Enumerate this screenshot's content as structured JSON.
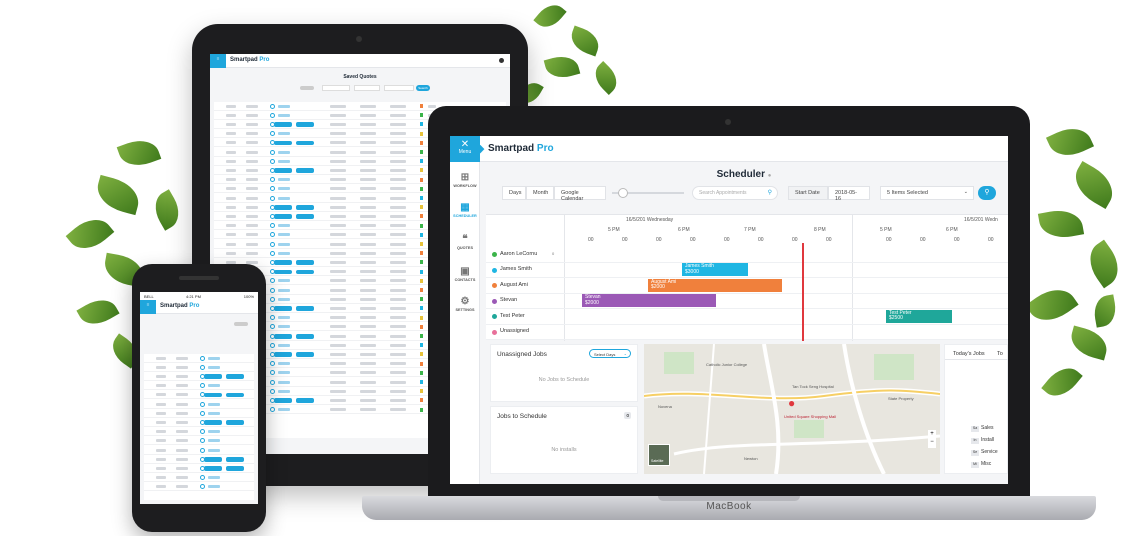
{
  "colors": {
    "accent": "#1fa6dc",
    "aaron": "#3bb44a",
    "james": "#1fb6e3",
    "august": "#f0803c",
    "stevan": "#9b59b6",
    "test_peter": "#1fa79a",
    "unassigned": "#e8709a",
    "now_line": "#e0383e"
  },
  "laptop": {
    "brand": "Smartpad",
    "brand_pro": "Pro",
    "menu_label": "Menu",
    "sidebar": [
      {
        "label": "WORKFLOW",
        "icon": "workflow-icon"
      },
      {
        "label": "SCHEDULER",
        "icon": "calendar-icon",
        "active": true
      },
      {
        "label": "QUOTES",
        "icon": "quotes-icon"
      },
      {
        "label": "CONTACTS",
        "icon": "contacts-icon"
      },
      {
        "label": "SETTINGS",
        "icon": "gear-icon"
      }
    ],
    "page_title": "Scheduler",
    "toolbar": {
      "days": "Days",
      "month": "Month",
      "google_calendar": "Google Calendar",
      "search_placeholder": "Search Appointments",
      "start_date_label": "Start Date",
      "start_date_value": "2018-05-16",
      "items_selected": "5 Items Selected"
    },
    "grid": {
      "date_heading_1": "16/5/201 Wednesday",
      "date_heading_2": "16/5/201 Wedn",
      "hours": [
        "6 PM",
        "7 PM",
        "8 PM",
        "5 PM",
        "6 PM"
      ],
      "hour_first": "5 PM",
      "minute_label": "00",
      "resources": [
        {
          "name": "Aaron LeCornu",
          "badge": "0"
        },
        {
          "name": "James Smith"
        },
        {
          "name": "August Ami"
        },
        {
          "name": "Stevan"
        },
        {
          "name": "Test Peter"
        },
        {
          "name": "Unassigned"
        }
      ],
      "events": [
        {
          "label": "James Smith",
          "sub": "$3000"
        },
        {
          "label": "August Ami",
          "sub": "$2000"
        },
        {
          "label": "Stevan",
          "sub": "$2000"
        },
        {
          "label": "Test Peter",
          "sub": "$2500"
        }
      ]
    },
    "unassigned_jobs": {
      "title": "Unassigned Jobs",
      "select": "Select Days",
      "empty": "No Jobs to Schedule"
    },
    "jobs_to_schedule": {
      "title": "Jobs to Schedule",
      "count": "0",
      "empty": "No installs"
    },
    "today_jobs": {
      "tab1": "Today's Jobs",
      "tab2": "To"
    },
    "legend": [
      {
        "badge": "Sa",
        "label": "Sales"
      },
      {
        "badge": "In",
        "label": "Install"
      },
      {
        "badge": "Se",
        "label": "Service"
      },
      {
        "badge": "Mi",
        "label": "Misc"
      }
    ],
    "map_labels": [
      "Catholic Junior College",
      "Tan Tock Seng Hospital",
      "United Square Shopping Mall",
      "Novena",
      "Newton",
      "State Property"
    ],
    "map_type": "Satellite"
  },
  "tablet": {
    "brand": "Smartpad",
    "brand_pro": "Pro",
    "title": "Saved Quotes",
    "search_label": "Search"
  },
  "phone": {
    "carrier": "BELL",
    "time": "4:21 PM",
    "battery": "100%",
    "brand": "Smartpad",
    "brand_pro": "Pro"
  },
  "macbook_label": "MacBook"
}
